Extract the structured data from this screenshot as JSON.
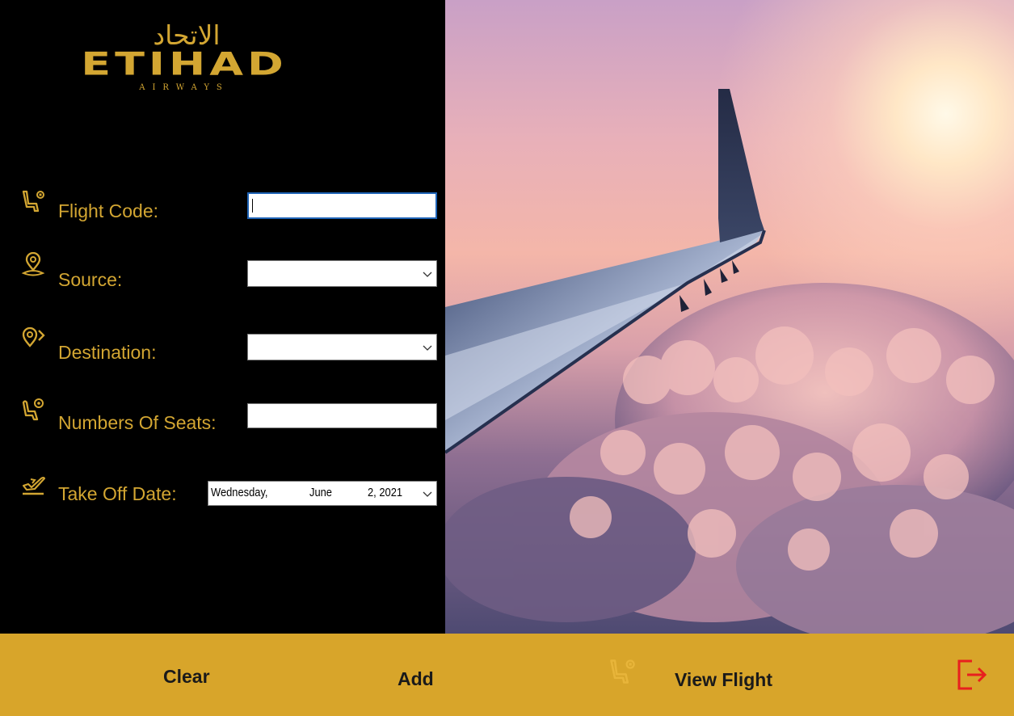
{
  "logo": {
    "arabic": "الاتحاد",
    "main": "ETIHAD",
    "sub": "AIRWAYS"
  },
  "form": {
    "flight_code": {
      "label": "Flight Code:",
      "value": ""
    },
    "source": {
      "label": "Source:",
      "value": ""
    },
    "destination": {
      "label": "Destination:",
      "value": ""
    },
    "seats": {
      "label": "Numbers Of Seats:",
      "value": ""
    },
    "takeoff": {
      "label": "Take Off Date:",
      "weekday": "Wednesday,",
      "month": "June",
      "day_year": "2, 2021"
    }
  },
  "buttons": {
    "clear": "Clear",
    "add": "Add",
    "view_flight": "View Flight"
  },
  "colors": {
    "gold": "#d3a632",
    "bar": "#d8a52a",
    "exit": "#e8201e"
  },
  "icons": [
    "seat-flight-icon",
    "location-pin-icon",
    "destination-pin-icon",
    "seat-number-icon",
    "takeoff-plane-icon",
    "seat-flight-icon",
    "exit-icon"
  ]
}
